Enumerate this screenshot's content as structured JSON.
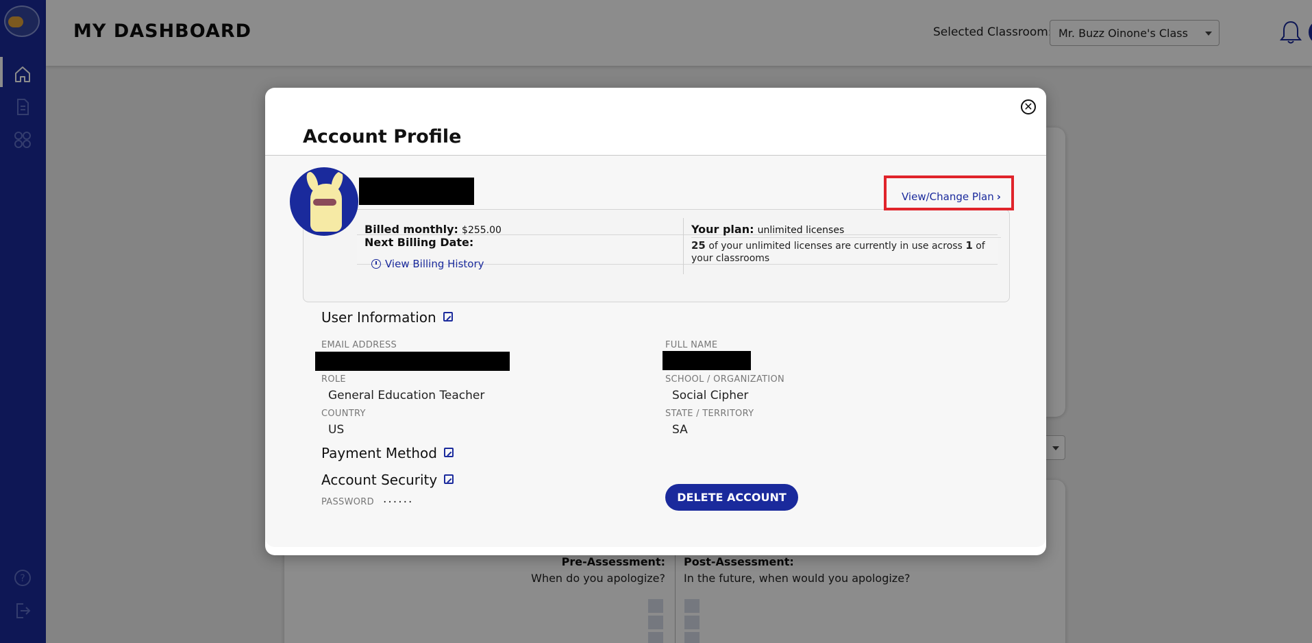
{
  "sidebar": {
    "logo": "app-logo",
    "nav_items": [
      {
        "name": "home",
        "icon": "home-icon",
        "active": true
      },
      {
        "name": "documents",
        "icon": "document-icon",
        "active": false
      },
      {
        "name": "apps",
        "icon": "grid-icon",
        "active": false
      }
    ],
    "bottom_items": [
      {
        "name": "help",
        "icon": "help-icon"
      },
      {
        "name": "logout",
        "icon": "logout-icon"
      }
    ],
    "color": "#1a2a9c"
  },
  "header": {
    "title": "MY DASHBOARD",
    "classroom_label": "Selected Classroom:",
    "classroom_value": "Mr. Buzz Oinone's Class",
    "notification_icon": "bell-icon",
    "avatar_icon": "avatar"
  },
  "background": {
    "pre_assessment_title": "Pre-Assessment:",
    "pre_assessment_question": "When do you apologize?",
    "post_assessment_title": "Post-Assessment:",
    "post_assessment_question": "In the future, when would you apologize?"
  },
  "modal": {
    "title": "Account Profile",
    "close_icon": "close-icon",
    "plan": {
      "view_change_label": "View/Change Plan",
      "billed_label": "Billed monthly:",
      "billed_amount": "$255.00",
      "next_billing_label": "Next Billing Date:",
      "billing_history_label": "View Billing History",
      "your_plan_label": "Your plan:",
      "your_plan_value": "unlimited licenses",
      "licenses_in_use": "25",
      "usage_text_1": "of your unlimited licenses are currently in use across",
      "classroom_count": "1",
      "usage_text_2": "of your classrooms"
    },
    "user_info": {
      "title": "User Information",
      "email_label": "EMAIL ADDRESS",
      "full_name_label": "FULL NAME",
      "role_label": "ROLE",
      "role_value": "General Education Teacher",
      "school_label": "SCHOOL / ORGANIZATION",
      "school_value": "Social Cipher",
      "country_label": "COUNTRY",
      "country_value": "US",
      "state_label": "STATE / TERRITORY",
      "state_value": "SA"
    },
    "payment": {
      "title": "Payment Method"
    },
    "security": {
      "title": "Account Security",
      "password_label": "PASSWORD",
      "password_value": "......"
    },
    "delete_label": "DELETE ACCOUNT",
    "accent_color": "#1a2a9c",
    "highlight_color": "#e0242b"
  }
}
